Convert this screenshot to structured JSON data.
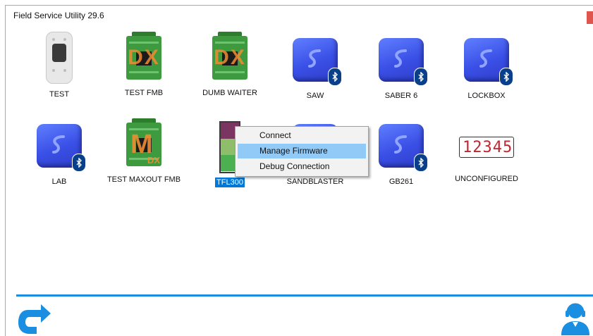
{
  "window": {
    "title": "Field Service Utility 29.6"
  },
  "devices": [
    {
      "label": "TEST",
      "icon": "white-module-icon"
    },
    {
      "label": "TEST FMB",
      "icon": "green-dx-module-icon",
      "overlay": "DX"
    },
    {
      "label": "DUMB WAITER",
      "icon": "green-dx-module-icon",
      "overlay": "DX"
    },
    {
      "label": "SAW",
      "icon": "blue-bluetooth-device-icon"
    },
    {
      "label": "SABER 6",
      "icon": "blue-bluetooth-device-icon"
    },
    {
      "label": "LOCKBOX",
      "icon": "blue-bluetooth-device-icon"
    },
    {
      "label": "LAB",
      "icon": "blue-bluetooth-device-icon"
    },
    {
      "label": "TEST MAXOUT FMB",
      "icon": "green-mdx-module-icon",
      "overlay_main": "M",
      "overlay_sub": "DX"
    },
    {
      "label": "TFL300",
      "icon": "tfl-device-icon",
      "selected": true
    },
    {
      "label": "SANDBLASTER",
      "icon": "blue-bluetooth-device-icon"
    },
    {
      "label": "GB261",
      "icon": "blue-bluetooth-device-icon"
    },
    {
      "label": "UNCONFIGURED",
      "icon": "seven-segment-display-icon",
      "display_text": "12345"
    }
  ],
  "context_menu": {
    "items": [
      {
        "label": "Connect"
      },
      {
        "label": "Manage Firmware",
        "highlighted": true
      },
      {
        "label": "Debug Connection"
      }
    ]
  },
  "colors": {
    "accent": "#1a8ee0",
    "selection": "#0078d7",
    "menu_highlight": "#91c9f7",
    "device_blue": "#3a4fe6",
    "module_green": "#3e9a3e",
    "overlay_orange": "#f08c32",
    "tfl_top": "#7a3560",
    "tfl_mid": "#8fbe6a",
    "tfl_bottom": "#4caf50"
  },
  "footer": {
    "left_icon": "refresh-arrow-icon",
    "right_icon": "support-agent-icon"
  }
}
